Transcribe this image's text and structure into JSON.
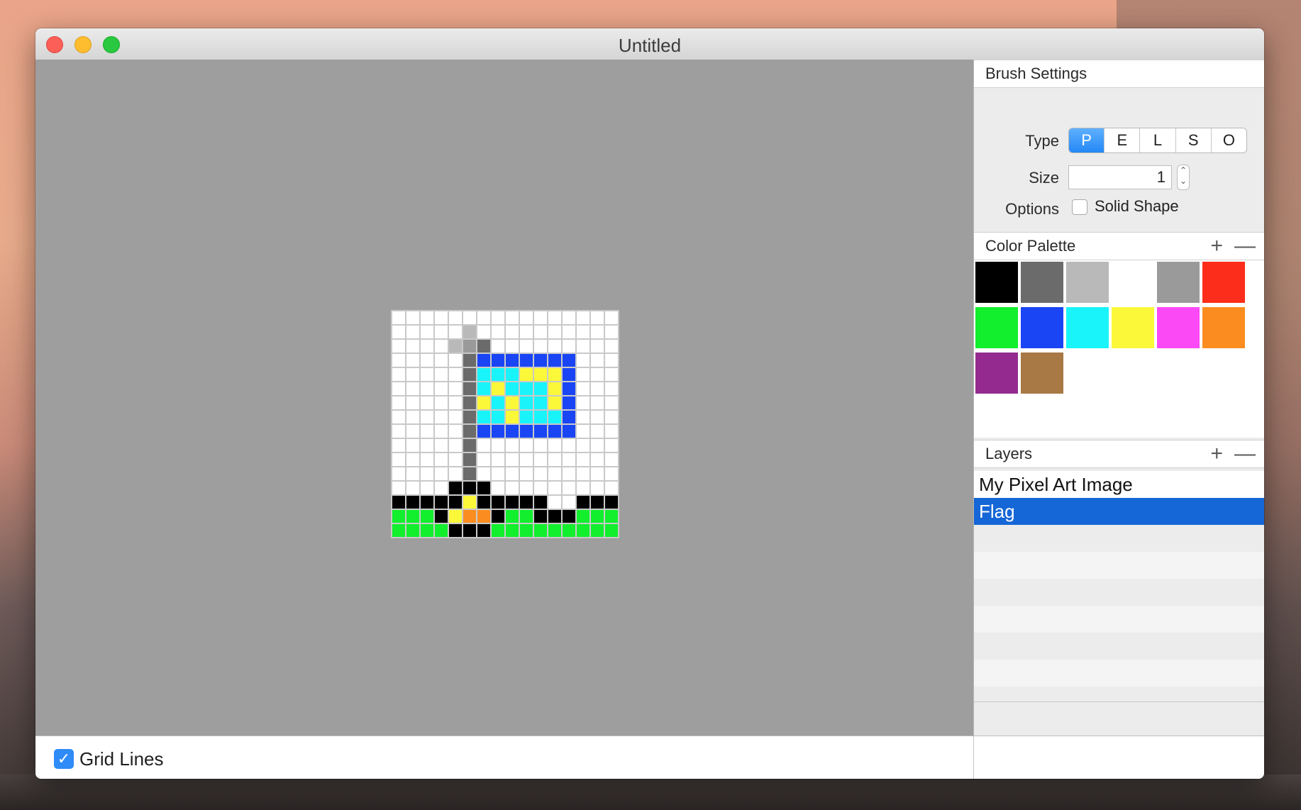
{
  "window": {
    "title": "Untitled"
  },
  "brush_settings": {
    "header": "Brush Settings",
    "type_label": "Type",
    "type_options": [
      "P",
      "E",
      "L",
      "S",
      "O"
    ],
    "type_selected": "P",
    "size_label": "Size",
    "size_value": "1",
    "options_label": "Options",
    "solid_shape_label": "Solid Shape",
    "solid_shape_checked": false
  },
  "color_palette": {
    "header": "Color Palette",
    "add_icon": "plus-icon",
    "remove_icon": "minus-icon",
    "swatches": [
      "#000000",
      "#6b6b6b",
      "#b9b9b9",
      "#ffffff",
      "#9a9a9a",
      "#fc2d1a",
      "#11ef2d",
      "#1a45f5",
      "#19f4fb",
      "#fbf83a",
      "#fb49f5",
      "#fb8d20",
      "#942a90",
      "#a87845"
    ]
  },
  "layers": {
    "header": "Layers",
    "items": [
      {
        "label": "My Pixel Art Image",
        "selected": false
      },
      {
        "label": "Flag",
        "selected": true
      }
    ]
  },
  "bottom_bar": {
    "grid_lines_label": "Grid Lines",
    "grid_lines_checked": true
  },
  "pixel_art": {
    "size": 16,
    "colors": {
      "w": "#ffffff",
      "k": "#000000",
      "g": "#6b6b6b",
      "l": "#b9b9b9",
      "m": "#9a9a9a",
      "b": "#1a45f5",
      "c": "#19f4fb",
      "y": "#fbf83a",
      "o": "#fb8d20",
      "G": "#11ef2d"
    },
    "rows": [
      "wwwwwwwwwwwwwwww",
      "wwwwwlwwwwwwwwww",
      "wwwwlmgwwwwwwwww",
      "wwwwwgbbbbbbbwww",
      "wwwwwgcccyyybwww",
      "wwwwwgcycccybwww",
      "wwwwwgycyccybwww",
      "wwwwwgccycccbwww",
      "wwwwwgbbbbbbbwww",
      "wwwwwgwwwwwwwwww",
      "wwwwwgwwwwwwwwww",
      "wwwwwgwwwwwwwwww",
      "wwwwkkkwwwwwwwww",
      "kkkkkykkkkkwwkkk",
      "GGGkyookGGkkkGGG",
      "GGGGkkkGGGGGGGGG"
    ]
  }
}
